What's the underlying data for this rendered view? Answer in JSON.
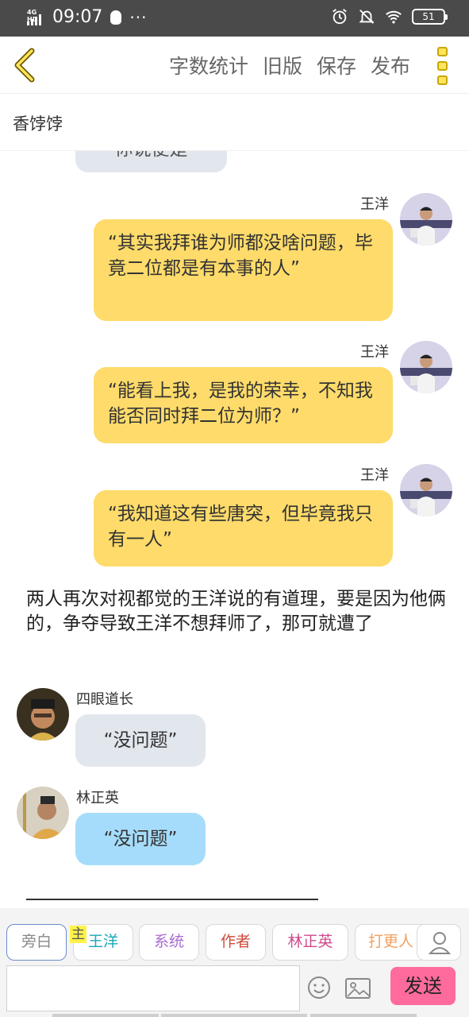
{
  "status_bar": {
    "network": "4G HD",
    "time": "09:07",
    "battery": "51"
  },
  "header": {
    "actions": [
      "字数统计",
      "旧版",
      "保存",
      "发布"
    ]
  },
  "story": {
    "title": "香饽饽"
  },
  "messages": {
    "partial": "你说便是",
    "m1": {
      "name": "王洋",
      "text": "“其实我拜谁为师都没啥问题，毕竟二位都是有本事的人”"
    },
    "m2": {
      "name": "王洋",
      "text": "“能看上我，是我的荣幸，不知我能否同时拜二位为师？”"
    },
    "m3": {
      "name": "王洋",
      "text": "“我知道这有些唐突，但毕竟我只有一人”"
    },
    "narration": "两人再次对视都觉的王洋说的有道理，要是因为他俩的，争夺导致王洋不想拜师了，那可就遭了",
    "m4": {
      "name": "四眼道长",
      "text": "“没问题”"
    },
    "m5": {
      "name": "林正英",
      "text": "“没问题”"
    }
  },
  "roles": [
    {
      "label": "旁白",
      "color": "#888888"
    },
    {
      "label": "王洋",
      "color": "#1aa7b8"
    },
    {
      "label": "系统",
      "color": "#a86bd0"
    },
    {
      "label": "作者",
      "color": "#d04a3a"
    },
    {
      "label": "林正英",
      "color": "#d04a8c"
    },
    {
      "label": "打更人",
      "color": "#f0a060"
    }
  ],
  "role_badge": "主",
  "composer": {
    "placeholder": "",
    "send_label": "发送"
  },
  "colors": {
    "accent_yellow": "#fedb6a",
    "accent_pink": "#ff6b9c",
    "bubble_gray": "#e2e6ed",
    "bubble_blue": "#a6dcfb"
  }
}
